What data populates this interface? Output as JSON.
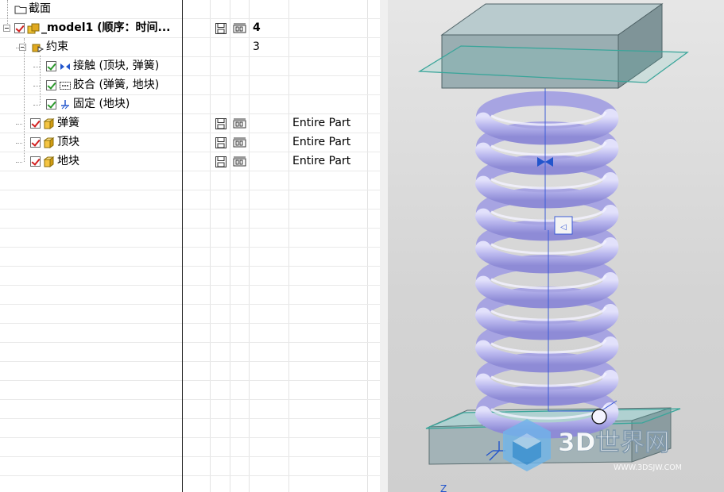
{
  "tree": {
    "rows": [
      {
        "id": "section",
        "label": "截面",
        "level": 0,
        "icon": "folder-icon",
        "checkbox": null,
        "save": false,
        "count": "",
        "ref": ""
      },
      {
        "id": "model",
        "label": "_model1 (顺序：时间...",
        "level": 0,
        "icon": "assembly-icon",
        "checkbox": "red",
        "save": true,
        "count": "4",
        "ref": "",
        "bold": true
      },
      {
        "id": "constraints",
        "label": "约束",
        "level": 1,
        "icon": "constraint-group-icon",
        "checkbox": null,
        "save": false,
        "count": "3",
        "ref": ""
      },
      {
        "id": "contact",
        "label": "接触 (顶块, 弹簧)",
        "level": 2,
        "icon": "touch-constraint-icon",
        "checkbox": "green",
        "save": false,
        "count": "",
        "ref": ""
      },
      {
        "id": "bond",
        "label": "胶合 (弹簧, 地块)",
        "level": 2,
        "icon": "bond-constraint-icon",
        "checkbox": "green",
        "save": false,
        "count": "",
        "ref": ""
      },
      {
        "id": "fix",
        "label": "固定 (地块)",
        "level": 2,
        "icon": "fix-constraint-icon",
        "checkbox": "green",
        "save": false,
        "count": "",
        "ref": ""
      },
      {
        "id": "spring",
        "label": "弹簧",
        "level": 1,
        "icon": "component-icon",
        "checkbox": "red",
        "save": true,
        "count": "",
        "ref": "Entire Part"
      },
      {
        "id": "topblock",
        "label": "顶块",
        "level": 1,
        "icon": "component-icon",
        "checkbox": "red",
        "save": true,
        "count": "",
        "ref": "Entire Part"
      },
      {
        "id": "groundblock",
        "label": "地块",
        "level": 1,
        "icon": "component-icon",
        "checkbox": "red",
        "save": true,
        "count": "",
        "ref": "Entire Part"
      }
    ]
  },
  "viewport": {
    "watermark_main": "3D世界网",
    "watermark_sub": "WWW.3DSJW.COM",
    "axis_label": "Z"
  },
  "colors": {
    "spring": "#b9b7ee",
    "block": "#9fb1b5",
    "plane": "#3aa59a",
    "constraint": "#2255cc",
    "watermark": "#2f8fd8"
  }
}
